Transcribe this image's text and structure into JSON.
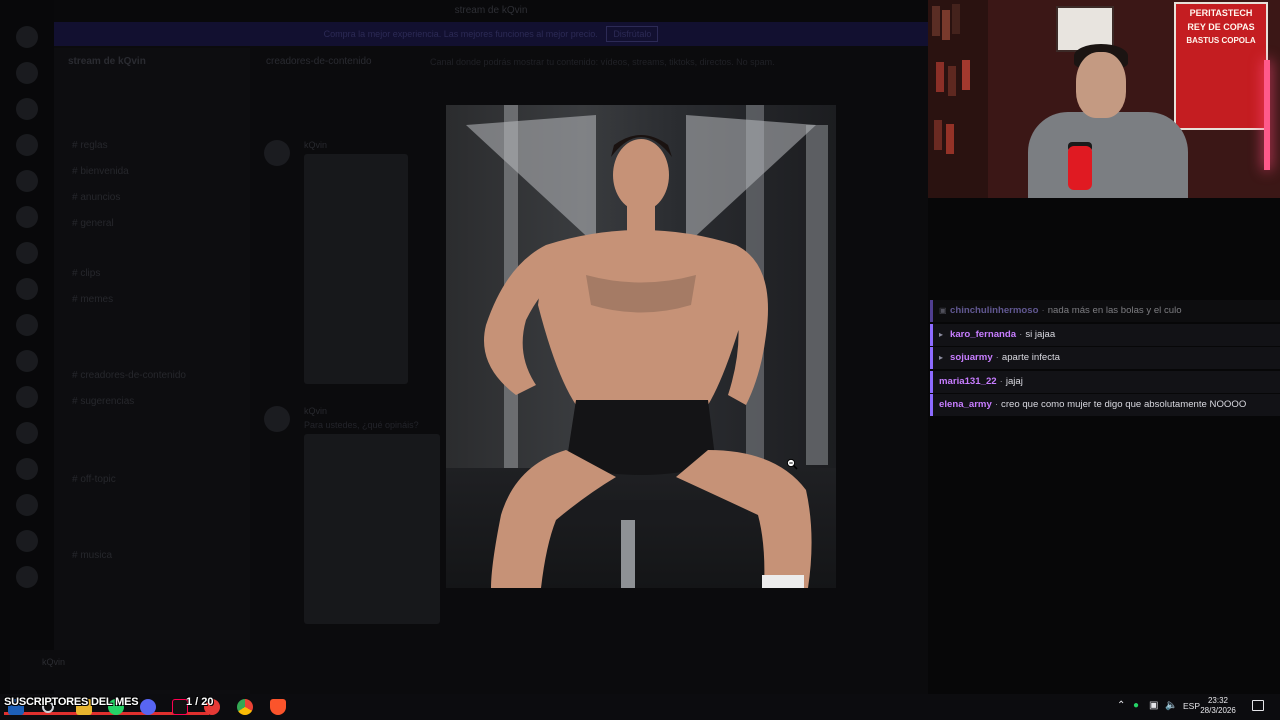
{
  "discord": {
    "window_title": "stream de kQvin",
    "banner_text": "Compra la mejor experiencia. Las mejores funciones al mejor precio.",
    "banner_button": "Disfrútalo",
    "server_name": "stream de kQvin",
    "channels": [
      "# reglas",
      "# bienvenida",
      "# anuncios",
      "# general",
      "# clips",
      "# memes",
      "# creadores-de-contenido",
      "# sugerencias",
      "# off-topic",
      "# musica"
    ],
    "channel_header": "creadores-de-contenido",
    "channel_topic": "Canal donde podrás mostrar tu contenido: vídeos, streams, tiktoks, directos. No spam.",
    "ghost_user_1": "kQvin",
    "ghost_user_2": "kQvin",
    "ghost_message": "Para ustedes, ¿qué opináis?",
    "current_user": "kQvin"
  },
  "chat": {
    "messages": [
      {
        "user": "chinchulinhermoso",
        "text": "nada más en las bolas y el culo",
        "color": "#a999ff",
        "badge": "shield",
        "faded": true
      },
      {
        "user": "karo_fernanda",
        "text": "si jajaa",
        "color": "#c77dff",
        "badge": "play",
        "faded": false
      },
      {
        "user": "sojuarmy",
        "text": "aparte infecta",
        "color": "#c77dff",
        "badge": "play",
        "faded": false
      },
      {
        "user": "maria131_22",
        "text": "jajaj",
        "color": "#c77dff",
        "badge": "",
        "faded": false
      },
      {
        "user": "elena_army",
        "text": "creo que como mujer te digo que absolutamente NOOOO",
        "color": "#c77dff",
        "badge": "",
        "faded": false
      }
    ]
  },
  "webcam": {
    "poster_title": "PERITASTECH",
    "poster_line_1": "REY DE COPAS",
    "poster_line_2": "BASTUS COPOLA"
  },
  "overlay": {
    "subs_label": "SUSCRIPTORES DEL MES",
    "subs_count": "1 / 20"
  },
  "taskbar": {
    "language": "ESP",
    "time": "23:32",
    "date": "28/3/2026"
  },
  "colors": {
    "chat_accent": "#8d6bff",
    "progress_red": "#e0302e"
  }
}
